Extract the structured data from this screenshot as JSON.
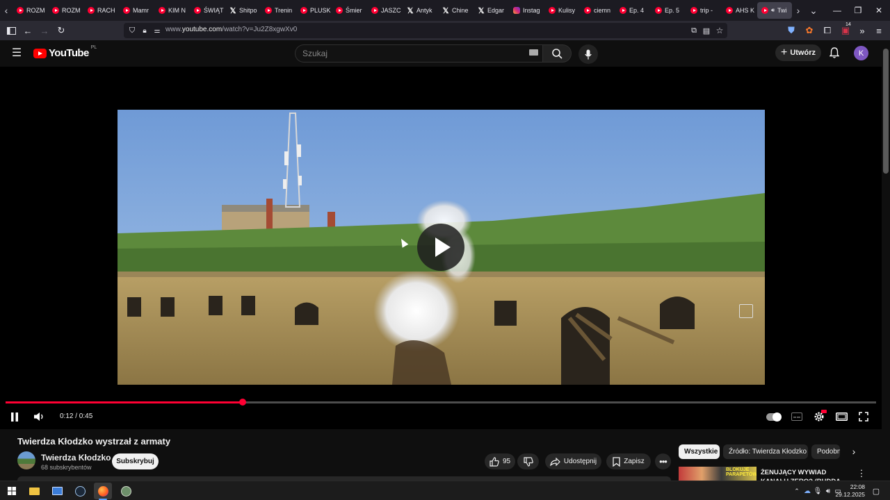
{
  "browser": {
    "tabs": [
      {
        "label": "ROZM",
        "icon": "youtube-icon"
      },
      {
        "label": "ROZM",
        "icon": "youtube-icon"
      },
      {
        "label": "RACH",
        "icon": "youtube-icon"
      },
      {
        "label": "Mamr",
        "icon": "youtube-icon"
      },
      {
        "label": "KIM N",
        "icon": "youtube-icon"
      },
      {
        "label": "ŚWIĄT",
        "icon": "youtube-icon"
      },
      {
        "label": "Shitpo",
        "icon": "x-icon"
      },
      {
        "label": "Trenin",
        "icon": "youtube-icon"
      },
      {
        "label": "PLUSK",
        "icon": "youtube-icon"
      },
      {
        "label": "Śmier",
        "icon": "youtube-icon"
      },
      {
        "label": "JASZC",
        "icon": "youtube-icon"
      },
      {
        "label": "Antyk",
        "icon": "x-icon"
      },
      {
        "label": "Chine",
        "icon": "x-icon"
      },
      {
        "label": "Edgar",
        "icon": "x-icon"
      },
      {
        "label": "Instag",
        "icon": "instagram-icon"
      },
      {
        "label": "Kulisy",
        "icon": "youtube-icon"
      },
      {
        "label": "ciemn",
        "icon": "youtube-icon"
      },
      {
        "label": "Ep. 4",
        "icon": "youtube-icon"
      },
      {
        "label": "Ep. 5",
        "icon": "youtube-icon"
      },
      {
        "label": "trip -",
        "icon": "youtube-icon"
      },
      {
        "label": "AHS K",
        "icon": "youtube-icon"
      },
      {
        "label": "Twi",
        "icon": "youtube-icon",
        "active": true
      }
    ],
    "url_prefix": "www.",
    "url_host": "youtube.com",
    "url_path": "/watch?v=Ju2Z8xgwXv0",
    "extension_badge": "14"
  },
  "masthead": {
    "logo_text": "YouTube",
    "country_code": "PL",
    "search_placeholder": "Szukaj",
    "create_label": "Utwórz",
    "avatar_letter": "K"
  },
  "player": {
    "current_time": "0:12",
    "duration": "0:45",
    "time_display": "0:12 / 0:45",
    "progress": 0.272,
    "accent_color": "#ff0033"
  },
  "video": {
    "title": "Twierdza Kłodzko wystrzał z armaty",
    "channel_name": "Twierdza Kłodzko",
    "subscribers": "68 subskrybentów",
    "subscribe_label": "Subskrybuj",
    "like_count": "95",
    "share_label": "Udostępnij",
    "save_label": "Zapisz"
  },
  "chips": [
    {
      "label": "Wszystkie",
      "selected": true
    },
    {
      "label": "Źródło: Twierdza Kłodzko",
      "selected": false
    },
    {
      "label": "Podobne",
      "selected": false
    }
  ],
  "recommendation": {
    "thumb_text": "BLOKUJE PARAPETÓW",
    "title": "ŻENUJĄCY WYWIAD KANAŁU ZERO? (BUDDA, STANOWSKI"
  },
  "taskbar": {
    "time": "22:08",
    "date": "29.12.2025"
  }
}
